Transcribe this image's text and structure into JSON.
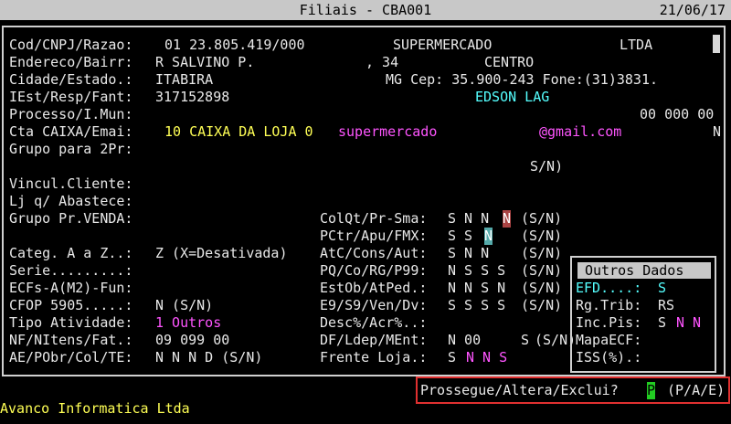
{
  "window": {
    "title": "Filiais - CBA001",
    "date": "21/06/17"
  },
  "labels": {
    "cod": "Cod/CNPJ/Razao:",
    "endereco": "Endereco/Bairr:",
    "cidade": "Cidade/Estado.:",
    "iest": "IEst/Resp/Fant:",
    "processo": "Processo/I.Mun:",
    "cta": "Cta CAIXA/Emai:",
    "grupo2pr": "Grupo para 2Pr:",
    "vincul": "Vincul.Cliente:",
    "ljq": "Lj q/ Abastece:",
    "grupovenda": "Grupo Pr.VENDA:",
    "categ": "Categ. A a Z..:",
    "serie": "Serie.........:",
    "ecfs": "ECFs-A(M2)-Fun:",
    "cfop": "CFOP 5905.....:",
    "tipoativ": "Tipo Atividade:",
    "nfitens": "NF/NItens/Fat.:",
    "aepobr": "AE/PObr/Col/TE:"
  },
  "values": {
    "cod": "01 23.805.419/000",
    "razao": "SUPERMERCADO",
    "ltda": "LTDA",
    "endereco": "R SALVINO P.",
    "numero": ", 34",
    "bairro": "CENTRO",
    "cidade": "ITABIRA",
    "uf_cep_fone": "MG Cep: 35.900-243 Fone:(31)3831.",
    "iest": "317152898",
    "fantasia": "EDSON LAG",
    "imun": "00 000 00",
    "cta": "10 CAIXA DA LOJA 0",
    "email_user": "supermercado",
    "email_domain": "@gmail.com",
    "cta_flag": "N",
    "sn_grupo": "S/N)",
    "categ": "Z (X=Desativada)",
    "cfop": "N (S/N)",
    "tipoativ": "1 Outros",
    "nfitens": "09 099 00",
    "aepobr": "N N N D (S/N)"
  },
  "mid": {
    "colqt": {
      "label": "ColQt/Pr-Sma:",
      "v1": "S N N",
      "v2": "N",
      "sn": "(S/N)"
    },
    "pctr": {
      "label": "PCtr/Apu/FMX:",
      "v1": "S S",
      "v2": "N",
      "sn": "(S/N)"
    },
    "atc": {
      "label": "AtC/Cons/Aut:",
      "v1": "S N N",
      "sn": "(S/N)"
    },
    "pq": {
      "label": "PQ/Co/RG/P99:",
      "v1": "N S S S",
      "sn": "(S/N)"
    },
    "estob": {
      "label": "EstOb/AtPed.:",
      "v1": "N N S N",
      "sn": "(S/N)"
    },
    "e9": {
      "label": "E9/S9/Ven/Dv:",
      "v1": "S S S S",
      "sn": "(S/N)"
    },
    "desc": {
      "label": "Desc%/Acr%..:"
    },
    "df": {
      "label": "DF/Ldep/MEnt:",
      "v1": "N 00",
      "v2": "S",
      "sn": "(S/N)"
    },
    "frente": {
      "label": "Frente Loja.:",
      "v1": "S",
      "v2": "N N S"
    }
  },
  "outros": {
    "title": "Outros Dados",
    "efd_label": "EFD....:",
    "efd_value": "S",
    "rgtrib_label": "Rg.Trib:",
    "rgtrib_value": "RS",
    "incpis_label": "Inc.Pis:",
    "incpis_v1": "S",
    "incpis_v2": "N N",
    "mapaecf_label": "MapaECF:",
    "iss_label": "ISS(%).:"
  },
  "prompt": {
    "text": "Prossegue/Altera/Exclui?",
    "cursor": "P",
    "options": "(P/A/E)"
  },
  "footer": {
    "company": "Avanco Informatica Ltda"
  }
}
